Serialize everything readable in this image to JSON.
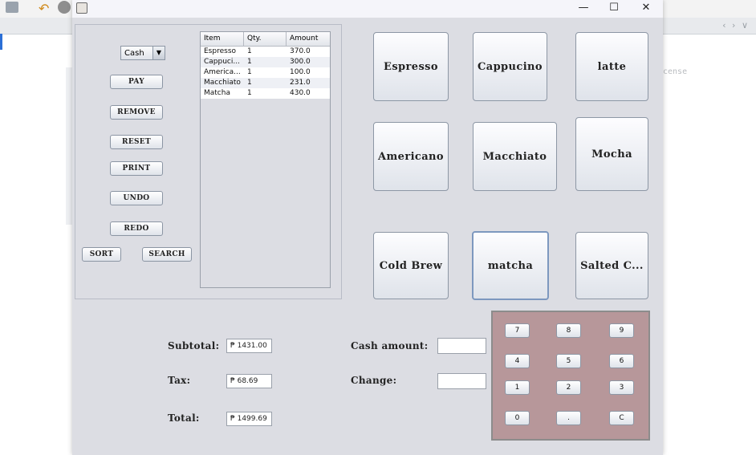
{
  "window": {
    "minimize_glyph": "—",
    "maximize_glyph": "☐",
    "close_glyph": "✕"
  },
  "payment": {
    "selected": "Cash"
  },
  "actions": {
    "pay": "PAY",
    "remove": "REMOVE",
    "reset": "RESET",
    "print": "PRINT",
    "undo": "UNDO",
    "redo": "REDO",
    "sort": "SORT",
    "search": "SEARCH"
  },
  "order": {
    "columns": [
      "Item",
      "Qty.",
      "Amount"
    ],
    "rows": [
      {
        "item": "Espresso",
        "qty": "1",
        "amount": "370.0"
      },
      {
        "item": "Cappuci...",
        "qty": "1",
        "amount": "300.0"
      },
      {
        "item": "America...",
        "qty": "1",
        "amount": "100.0"
      },
      {
        "item": "Macchiato",
        "qty": "1",
        "amount": "231.0"
      },
      {
        "item": "Matcha",
        "qty": "1",
        "amount": "430.0"
      }
    ]
  },
  "menu": {
    "espresso": "Espresso",
    "cappucino": "Cappucino",
    "latte": "latte",
    "americano": "Americano",
    "macchiato": "Macchiato",
    "mocha": "Mocha",
    "cold_brew": "Cold Brew",
    "matcha": "matcha",
    "salted": "Salted C..."
  },
  "totals": {
    "subtotal_label": "Subtotal:",
    "subtotal": "₱ 1431.00",
    "tax_label": "Tax:",
    "tax": "₱ 68.69",
    "total_label": "Total:",
    "total": "₱ 1499.69",
    "cash_label": "Cash amount:",
    "cash": "",
    "change_label": "Change:",
    "change": ""
  },
  "keypad": {
    "keys": [
      "7",
      "8",
      "9",
      "4",
      "5",
      "6",
      "1",
      "2",
      "3",
      "0",
      ".",
      "C"
    ]
  },
  "background": {
    "ghost_text": "cense",
    "nav_arrows": "‹ › ∨"
  },
  "colors": {
    "keypad_bg": "#b7979a",
    "window_bg": "#dcdde3"
  }
}
